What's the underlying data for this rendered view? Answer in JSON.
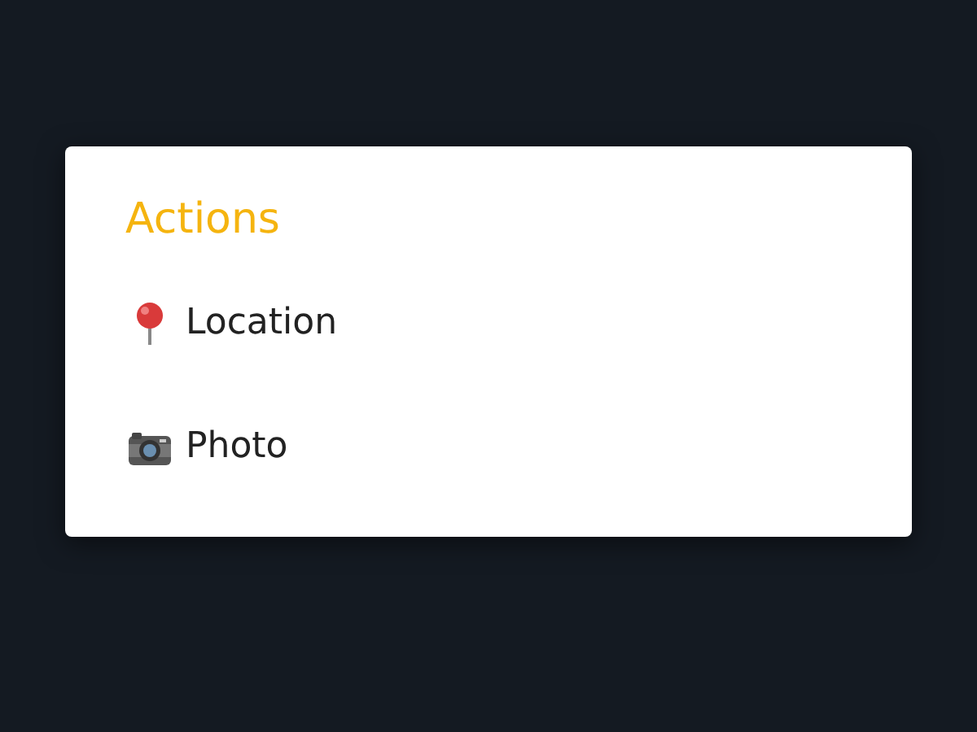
{
  "dialog": {
    "title": "Actions",
    "items": [
      {
        "kind": "location",
        "label": "Location"
      },
      {
        "kind": "camera",
        "label": "Photo"
      }
    ]
  }
}
